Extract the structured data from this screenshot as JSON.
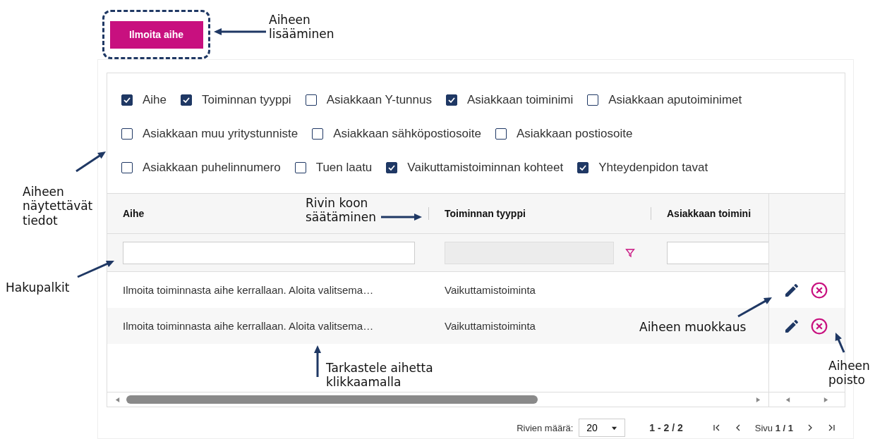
{
  "add_button": {
    "label": "Ilmoita aihe"
  },
  "column_picker": {
    "options": [
      {
        "label": "Aihe",
        "checked": true
      },
      {
        "label": "Toiminnan tyyppi",
        "checked": true
      },
      {
        "label": "Asiakkaan Y-tunnus",
        "checked": false
      },
      {
        "label": "Asiakkaan toiminimi",
        "checked": true
      },
      {
        "label": "Asiakkaan aputoiminimet",
        "checked": false
      },
      {
        "label": "Asiakkaan muu yritystunniste",
        "checked": false
      },
      {
        "label": "Asiakkaan sähköpostiosoite",
        "checked": false
      },
      {
        "label": "Asiakkaan postiosoite",
        "checked": false
      },
      {
        "label": "Asiakkaan puhelinnumero",
        "checked": false
      },
      {
        "label": "Tuen laatu",
        "checked": false
      },
      {
        "label": "Vaikuttamistoiminnan kohteet",
        "checked": true
      },
      {
        "label": "Yhteydenpidon tavat",
        "checked": true
      }
    ]
  },
  "table": {
    "columns": [
      {
        "label": "Aihe",
        "filter_disabled": false,
        "filter_icon": false
      },
      {
        "label": "Toiminnan tyyppi",
        "filter_disabled": true,
        "filter_icon": true
      },
      {
        "label": "Asiakkaan toimini",
        "filter_disabled": false,
        "filter_icon": false
      }
    ],
    "rows": [
      [
        "Ilmoita toiminnasta aihe kerrallaan. Aloita valitsema…",
        "Vaikuttamistoiminta"
      ],
      [
        "Ilmoita toiminnasta aihe kerrallaan. Aloita valitsema…",
        "Vaikuttamistoiminta"
      ]
    ]
  },
  "pagination": {
    "rows_label": "Rivien määrä:",
    "page_size": "20",
    "range": "1 - 2 / 2",
    "page": "Sivu **1 / 1**"
  },
  "annotations": [
    {
      "lines": [
        "Aiheen",
        "lisääminen"
      ]
    },
    {
      "lines": [
        "Aiheen",
        "näytettävät",
        "tiedot"
      ]
    },
    {
      "lines": [
        "Rivin koon",
        "säätäminen"
      ]
    },
    {
      "lines": [
        "Hakupalkit"
      ]
    },
    {
      "lines": [
        "Aiheen muokkaus"
      ]
    },
    {
      "lines": [
        "Tarkastele aihetta",
        "klikkaamalla"
      ]
    },
    {
      "lines": [
        "Aiheen",
        "poisto"
      ]
    }
  ]
}
